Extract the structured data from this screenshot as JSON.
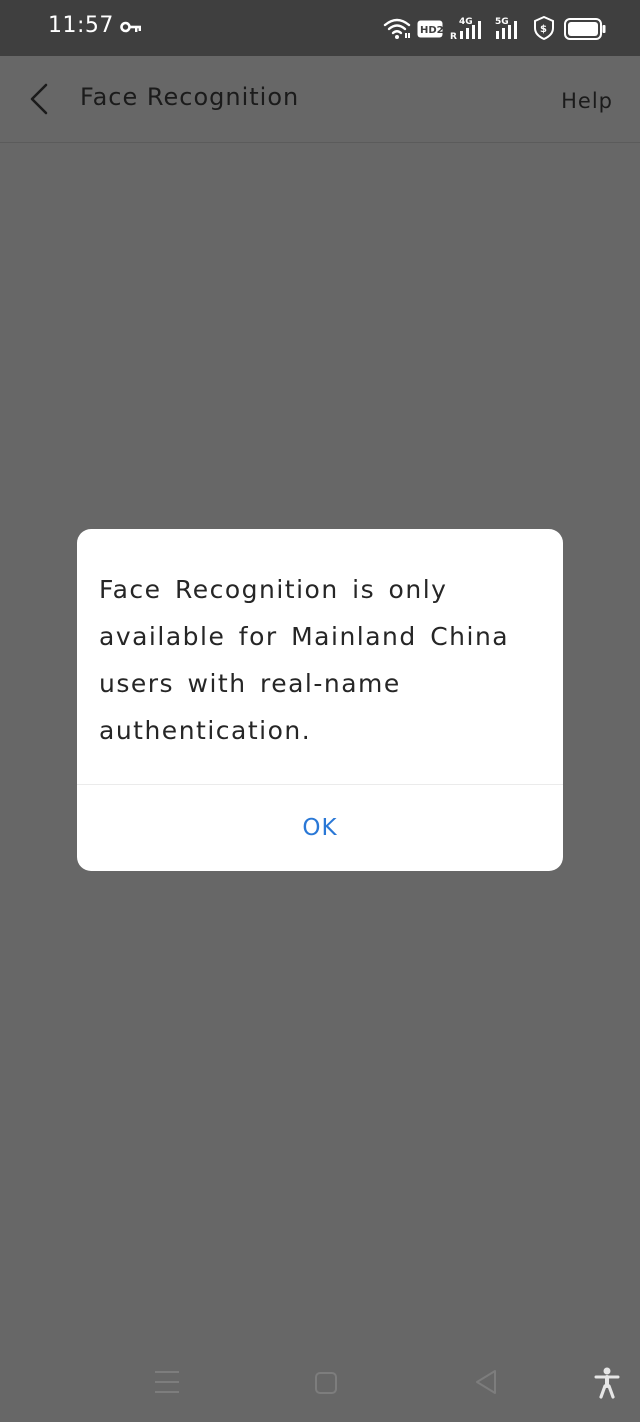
{
  "status_bar": {
    "time": "11:57",
    "icons": [
      "key-icon",
      "wifi-icon",
      "hd-icon",
      "signal-4g-icon",
      "signal-5g-icon",
      "shield-icon",
      "battery-icon"
    ],
    "hd_label": "HD2",
    "network_1": "4G",
    "network_1_sub": "R",
    "network_2": "5G"
  },
  "header": {
    "title": "Face Recognition",
    "help_label": "Help"
  },
  "dialog": {
    "message": "Face Recognition is only available for Mainland China users with real-name authentication.",
    "ok_label": "OK"
  },
  "nav_bar": {
    "icons": [
      "menu-icon",
      "home-icon",
      "back-triangle-icon",
      "accessibility-icon"
    ]
  },
  "colors": {
    "status_bar_bg": "#3f3f3f",
    "page_bg": "#676767",
    "dialog_bg": "#ffffff",
    "ok_button": "#2a78d6"
  }
}
